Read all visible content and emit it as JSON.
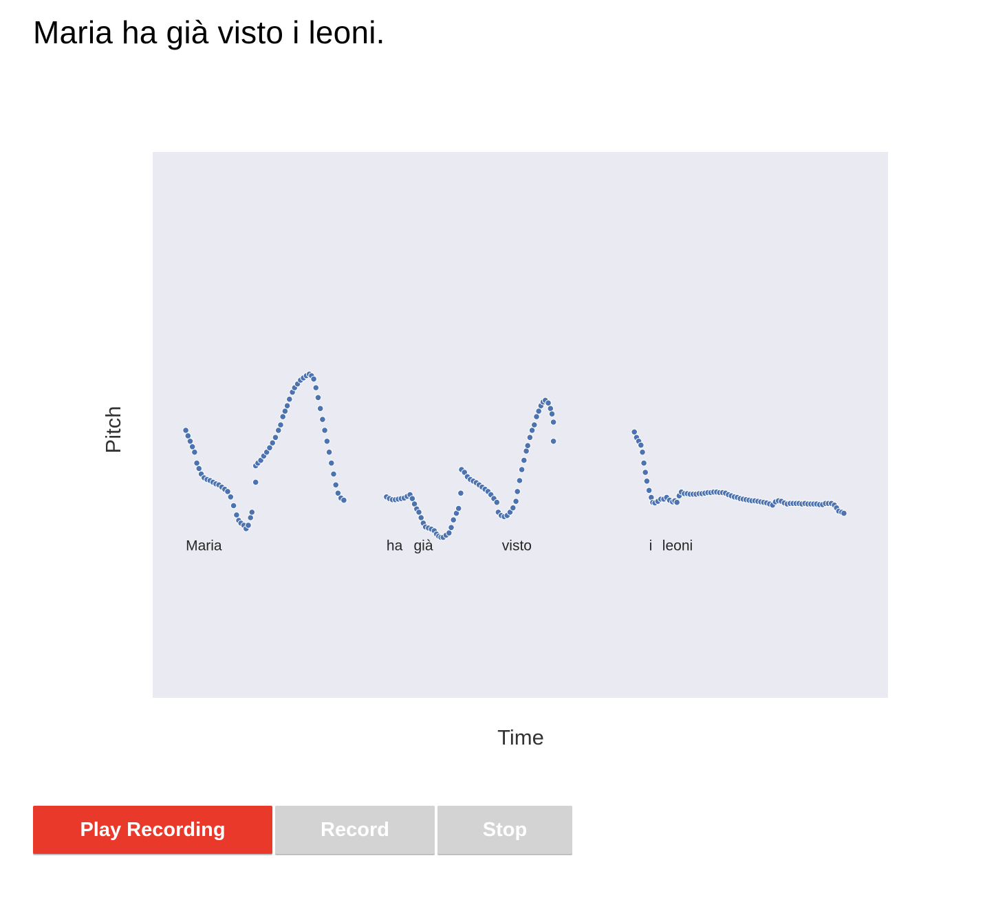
{
  "sentence": "Maria ha già visto i leoni.",
  "buttons": {
    "play_label": "Play Recording",
    "record_label": "Record",
    "stop_label": "Stop"
  },
  "colors": {
    "play_bg": "#e8392b",
    "disabled_bg": "#d3d3d3",
    "plot_bg": "#eaeaf2",
    "point": "#4c72b0"
  },
  "chart_data": {
    "type": "scatter",
    "xlabel": "Time",
    "ylabel": "Pitch",
    "grid": false,
    "xlim": [
      0,
      100
    ],
    "ylim": [
      0,
      100
    ],
    "word_labels": [
      {
        "text": "Maria",
        "x": 4.5
      },
      {
        "text": "ha",
        "x": 31.8
      },
      {
        "text": "già",
        "x": 35.5
      },
      {
        "text": "visto",
        "x": 47.5
      },
      {
        "text": "i",
        "x": 67.5
      },
      {
        "text": "leoni",
        "x": 69.3
      }
    ],
    "word_label_y": 27,
    "series": [
      {
        "points": [
          [
            4.5,
            49
          ],
          [
            4.8,
            48
          ],
          [
            5.1,
            47
          ],
          [
            5.4,
            46
          ],
          [
            5.7,
            45
          ],
          [
            6.0,
            43
          ],
          [
            6.3,
            42
          ],
          [
            6.6,
            41
          ],
          [
            7.0,
            40.3
          ],
          [
            7.4,
            40
          ],
          [
            7.8,
            39.8
          ],
          [
            8.2,
            39.5
          ],
          [
            8.6,
            39.2
          ],
          [
            9.0,
            39
          ],
          [
            9.4,
            38.6
          ],
          [
            9.8,
            38.2
          ],
          [
            10.2,
            37.8
          ],
          [
            10.6,
            36.8
          ],
          [
            11.0,
            35.2
          ],
          [
            11.4,
            33.5
          ],
          [
            11.7,
            32.5
          ],
          [
            12.0,
            32
          ],
          [
            12.4,
            31.6
          ],
          [
            12.7,
            31
          ],
          [
            13.0,
            31.6
          ],
          [
            13.3,
            33
          ],
          [
            13.5,
            34
          ]
        ]
      },
      {
        "points": [
          [
            14.0,
            39.5
          ],
          [
            14.0,
            42.5
          ],
          [
            14.3,
            43
          ],
          [
            14.7,
            43.5
          ],
          [
            15.1,
            44.3
          ],
          [
            15.5,
            45
          ],
          [
            15.9,
            45.8
          ],
          [
            16.3,
            46.7
          ],
          [
            16.7,
            47.7
          ],
          [
            17.1,
            49
          ],
          [
            17.4,
            50
          ],
          [
            17.7,
            51.5
          ],
          [
            18.0,
            52.5
          ],
          [
            18.3,
            53.5
          ],
          [
            18.6,
            54.7
          ],
          [
            19.0,
            56
          ],
          [
            19.3,
            56.8
          ],
          [
            19.7,
            57.5
          ],
          [
            20.1,
            58.2
          ],
          [
            20.5,
            58.6
          ],
          [
            20.9,
            59
          ],
          [
            21.3,
            59.3
          ],
          [
            21.6,
            59
          ],
          [
            21.9,
            58.4
          ],
          [
            22.2,
            56.8
          ],
          [
            22.5,
            55
          ],
          [
            22.8,
            53
          ],
          [
            23.1,
            51
          ],
          [
            23.4,
            49
          ],
          [
            23.7,
            47
          ],
          [
            24.0,
            45
          ],
          [
            24.3,
            43
          ],
          [
            24.6,
            41
          ],
          [
            24.9,
            39
          ],
          [
            25.2,
            37.5
          ],
          [
            25.6,
            36.6
          ],
          [
            26.0,
            36.2
          ]
        ]
      },
      {
        "points": [
          [
            31.8,
            36.8
          ],
          [
            32.2,
            36.5
          ],
          [
            32.6,
            36.3
          ],
          [
            33.0,
            36.3
          ],
          [
            33.4,
            36.4
          ],
          [
            33.8,
            36.5
          ],
          [
            34.2,
            36.6
          ],
          [
            34.6,
            36.9
          ],
          [
            35.0,
            37.2
          ],
          [
            35.3,
            36.5
          ],
          [
            35.6,
            35.5
          ],
          [
            35.9,
            34.6
          ],
          [
            36.2,
            34
          ],
          [
            36.5,
            33
          ],
          [
            36.8,
            32
          ],
          [
            37.1,
            31.3
          ],
          [
            37.5,
            31.1
          ],
          [
            37.9,
            30.9
          ],
          [
            38.3,
            30.6
          ],
          [
            38.6,
            30
          ],
          [
            38.9,
            29.6
          ],
          [
            39.2,
            29.4
          ],
          [
            39.5,
            29.4
          ],
          [
            39.9,
            29.8
          ],
          [
            40.3,
            30.2
          ],
          [
            40.6,
            31.2
          ],
          [
            40.9,
            32.6
          ],
          [
            41.3,
            33.8
          ],
          [
            41.6,
            34.7
          ],
          [
            41.9,
            37.5
          ],
          [
            42.0,
            41.8
          ],
          [
            42.4,
            41.3
          ],
          [
            42.8,
            40.5
          ],
          [
            43.2,
            40
          ],
          [
            43.6,
            39.7
          ],
          [
            44.0,
            39.4
          ],
          [
            44.4,
            39
          ],
          [
            44.8,
            38.6
          ],
          [
            45.2,
            38.2
          ],
          [
            45.6,
            37.8
          ],
          [
            46.0,
            37.2
          ],
          [
            46.4,
            36.5
          ],
          [
            46.8,
            35.8
          ],
          [
            47.0,
            34
          ],
          [
            47.4,
            33.4
          ],
          [
            47.8,
            33.2
          ],
          [
            48.2,
            33.4
          ],
          [
            48.6,
            34
          ],
          [
            49.0,
            34.8
          ],
          [
            49.4,
            36
          ],
          [
            49.6,
            37.8
          ],
          [
            49.9,
            39.8
          ],
          [
            50.2,
            41.8
          ],
          [
            50.5,
            43.5
          ],
          [
            50.8,
            45.2
          ],
          [
            51.0,
            46.2
          ],
          [
            51.3,
            47.7
          ],
          [
            51.6,
            49
          ],
          [
            51.9,
            50
          ],
          [
            52.2,
            51.5
          ],
          [
            52.5,
            52.5
          ],
          [
            52.8,
            53.5
          ],
          [
            53.1,
            54.2
          ],
          [
            53.4,
            54.5
          ],
          [
            53.8,
            54
          ],
          [
            54.1,
            53
          ],
          [
            54.3,
            52
          ],
          [
            54.5,
            50.5
          ],
          [
            54.5,
            47
          ]
        ]
      },
      {
        "points": [
          [
            65.5,
            48.7
          ],
          [
            65.8,
            47.7
          ],
          [
            66.1,
            47
          ],
          [
            66.4,
            46.3
          ],
          [
            66.6,
            45
          ],
          [
            66.8,
            43
          ],
          [
            67.0,
            41.3
          ],
          [
            67.2,
            39.7
          ],
          [
            67.5,
            38
          ],
          [
            67.8,
            36.7
          ],
          [
            68.0,
            35.8
          ],
          [
            68.3,
            35.7
          ],
          [
            68.7,
            36
          ],
          [
            69.1,
            36.4
          ],
          [
            69.5,
            36.4
          ],
          [
            69.9,
            36.7
          ],
          [
            70.3,
            36.2
          ],
          [
            70.7,
            35.9
          ],
          [
            71.0,
            36.1
          ],
          [
            71.3,
            35.8
          ],
          [
            71.6,
            37
          ],
          [
            71.9,
            37.7
          ],
          [
            72.3,
            37.4
          ],
          [
            72.7,
            37.4
          ],
          [
            73.1,
            37.3
          ],
          [
            73.5,
            37.3
          ],
          [
            73.9,
            37.3
          ],
          [
            74.3,
            37.4
          ],
          [
            74.7,
            37.4
          ],
          [
            75.1,
            37.5
          ],
          [
            75.5,
            37.6
          ],
          [
            75.9,
            37.6
          ],
          [
            76.3,
            37.7
          ],
          [
            76.7,
            37.7
          ],
          [
            77.1,
            37.6
          ],
          [
            77.5,
            37.6
          ],
          [
            77.9,
            37.5
          ],
          [
            78.3,
            37.2
          ],
          [
            78.7,
            37
          ],
          [
            79.1,
            36.8
          ],
          [
            79.5,
            36.7
          ],
          [
            79.9,
            36.5
          ],
          [
            80.3,
            36.4
          ],
          [
            80.7,
            36.3
          ],
          [
            81.1,
            36.2
          ],
          [
            81.5,
            36.1
          ],
          [
            81.9,
            36.1
          ],
          [
            82.3,
            36
          ],
          [
            82.7,
            35.9
          ],
          [
            83.1,
            35.8
          ],
          [
            83.5,
            35.7
          ],
          [
            83.9,
            35.5
          ],
          [
            84.3,
            35.3
          ],
          [
            84.7,
            35.9
          ],
          [
            85.1,
            36.1
          ],
          [
            85.5,
            36
          ],
          [
            85.9,
            35.7
          ],
          [
            86.3,
            35.5
          ],
          [
            86.7,
            35.6
          ],
          [
            87.1,
            35.6
          ],
          [
            87.5,
            35.6
          ],
          [
            87.9,
            35.6
          ],
          [
            88.3,
            35.5
          ],
          [
            88.7,
            35.6
          ],
          [
            89.1,
            35.5
          ],
          [
            89.5,
            35.5
          ],
          [
            89.9,
            35.5
          ],
          [
            90.3,
            35.5
          ],
          [
            90.7,
            35.4
          ],
          [
            91.1,
            35.4
          ],
          [
            91.5,
            35.6
          ],
          [
            91.9,
            35.6
          ],
          [
            92.3,
            35.6
          ],
          [
            92.7,
            35.3
          ],
          [
            93.0,
            34.8
          ],
          [
            93.3,
            34.2
          ],
          [
            93.7,
            34
          ],
          [
            94.0,
            33.8
          ]
        ]
      }
    ]
  }
}
